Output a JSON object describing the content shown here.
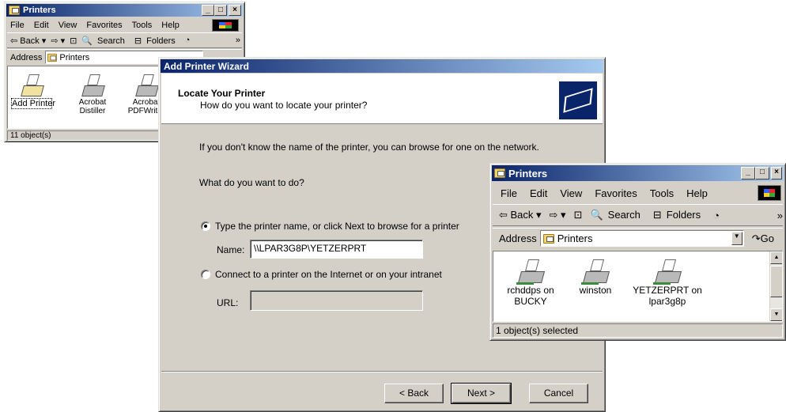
{
  "win1": {
    "title": "Printers",
    "menu": [
      "File",
      "Edit",
      "View",
      "Favorites",
      "Tools",
      "Help"
    ],
    "toolbar": {
      "back": "⇦ Back ▾",
      "fwd": "⇨ ▾",
      "up": "⊡",
      "search": "Search",
      "folders": "Folders",
      "more": "»"
    },
    "address_label": "Address",
    "address_value": "Printers",
    "items": [
      {
        "label": "Add Printer"
      },
      {
        "label": "Acrobat\nDistiller"
      },
      {
        "label": "Acrobat\nPDFWriter"
      }
    ],
    "status": "11 object(s)"
  },
  "wizard": {
    "title": "Add Printer Wizard",
    "heading": "Locate Your Printer",
    "subheading": "How do you want to locate your printer?",
    "intro": "If you don't know the name of the printer, you can browse for one on the network.",
    "question": "What do you want to do?",
    "option1": "Type the printer name, or click Next to browse for a printer",
    "name_label": "Name:",
    "name_value": "\\\\LPAR3G8P\\YETZERPRT",
    "option2": "Connect to a printer on the Internet or on your intranet",
    "url_label": "URL:",
    "back": "< Back",
    "next": "Next >",
    "cancel": "Cancel"
  },
  "win2": {
    "title": "Printers",
    "menu": [
      "File",
      "Edit",
      "View",
      "Favorites",
      "Tools",
      "Help"
    ],
    "toolbar": {
      "back": "⇦ Back ▾",
      "fwd": "⇨ ▾",
      "up": "⊡",
      "search": "Search",
      "folders": "Folders",
      "more": "»"
    },
    "address_label": "Address",
    "address_value": "Printers",
    "go": "Go",
    "items": [
      {
        "label": "rchddps on\nBUCKY"
      },
      {
        "label": "winston"
      },
      {
        "label": "YETZERPRT on\nlpar3g8p"
      }
    ],
    "status": "1 object(s) selected"
  }
}
